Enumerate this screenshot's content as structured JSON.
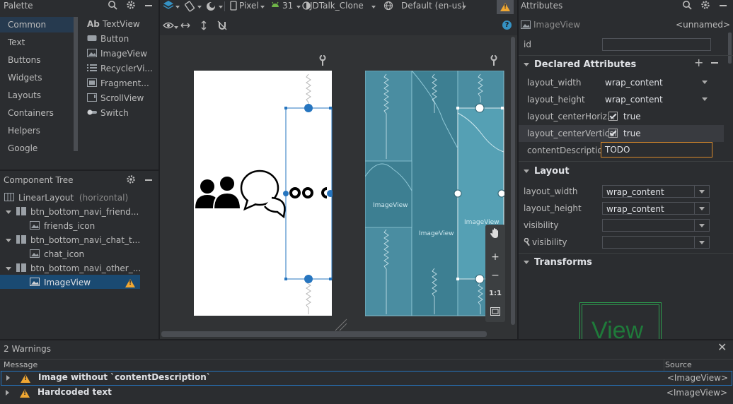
{
  "palette": {
    "title": "Palette",
    "categories": [
      "Common",
      "Text",
      "Buttons",
      "Widgets",
      "Layouts",
      "Containers",
      "Helpers",
      "Google"
    ],
    "items": [
      {
        "label": "TextView",
        "prefix": "Ab"
      },
      {
        "label": "Button"
      },
      {
        "label": "ImageView"
      },
      {
        "label": "RecyclerVi..."
      },
      {
        "label": "Fragment..."
      },
      {
        "label": "ScrollView"
      },
      {
        "label": "Switch"
      }
    ]
  },
  "toolbar": {
    "device": "Pixel",
    "api": "31",
    "theme": "JDTalk_Clone",
    "locale": "Default (en-us)"
  },
  "tree": {
    "title": "Component Tree",
    "rows": [
      {
        "label": "LinearLayout",
        "hint": "(horizontal)"
      },
      {
        "label": "btn_bottom_navi_friend..."
      },
      {
        "label": "friends_icon"
      },
      {
        "label": "btn_bottom_navi_chat_t..."
      },
      {
        "label": "chat_icon"
      },
      {
        "label": "btn_bottom_navi_other_..."
      },
      {
        "label": "ImageView"
      }
    ]
  },
  "design": {
    "blueprint_labels": [
      "ImageView",
      "ImageView",
      "ImageView"
    ],
    "zoom_reset": "1:1"
  },
  "attributes": {
    "title": "Attributes",
    "widget": "ImageView",
    "widget_id_hint": "<unnamed>",
    "id_label": "id",
    "id_value": "",
    "declared_title": "Declared Attributes",
    "declared": [
      {
        "name": "layout_width",
        "value": "wrap_content"
      },
      {
        "name": "layout_height",
        "value": "wrap_content"
      },
      {
        "name": "layout_centerHoriz...",
        "value": "true"
      },
      {
        "name": "layout_centerVertical",
        "value": "true"
      },
      {
        "name": "contentDescription",
        "value": "TODO"
      }
    ],
    "layout_title": "Layout",
    "layout": [
      {
        "name": "layout_width",
        "value": "wrap_content"
      },
      {
        "name": "layout_height",
        "value": "wrap_content"
      },
      {
        "name": "visibility",
        "value": ""
      },
      {
        "name": "visibility",
        "value": ""
      }
    ],
    "transforms_title": "Transforms",
    "preview_text": "View"
  },
  "problems": {
    "title": "2 Warnings",
    "col_message": "Message",
    "col_source": "Source",
    "rows": [
      {
        "message": "Image without `contentDescription`",
        "source": "<ImageView>"
      },
      {
        "message": "Hardcoded text",
        "source": "<ImageView>"
      }
    ]
  },
  "colors": {
    "accent": "#2675bf",
    "warning": "#f0a732",
    "blueprint": "#3d7f92",
    "selection": "#1a4a72"
  }
}
